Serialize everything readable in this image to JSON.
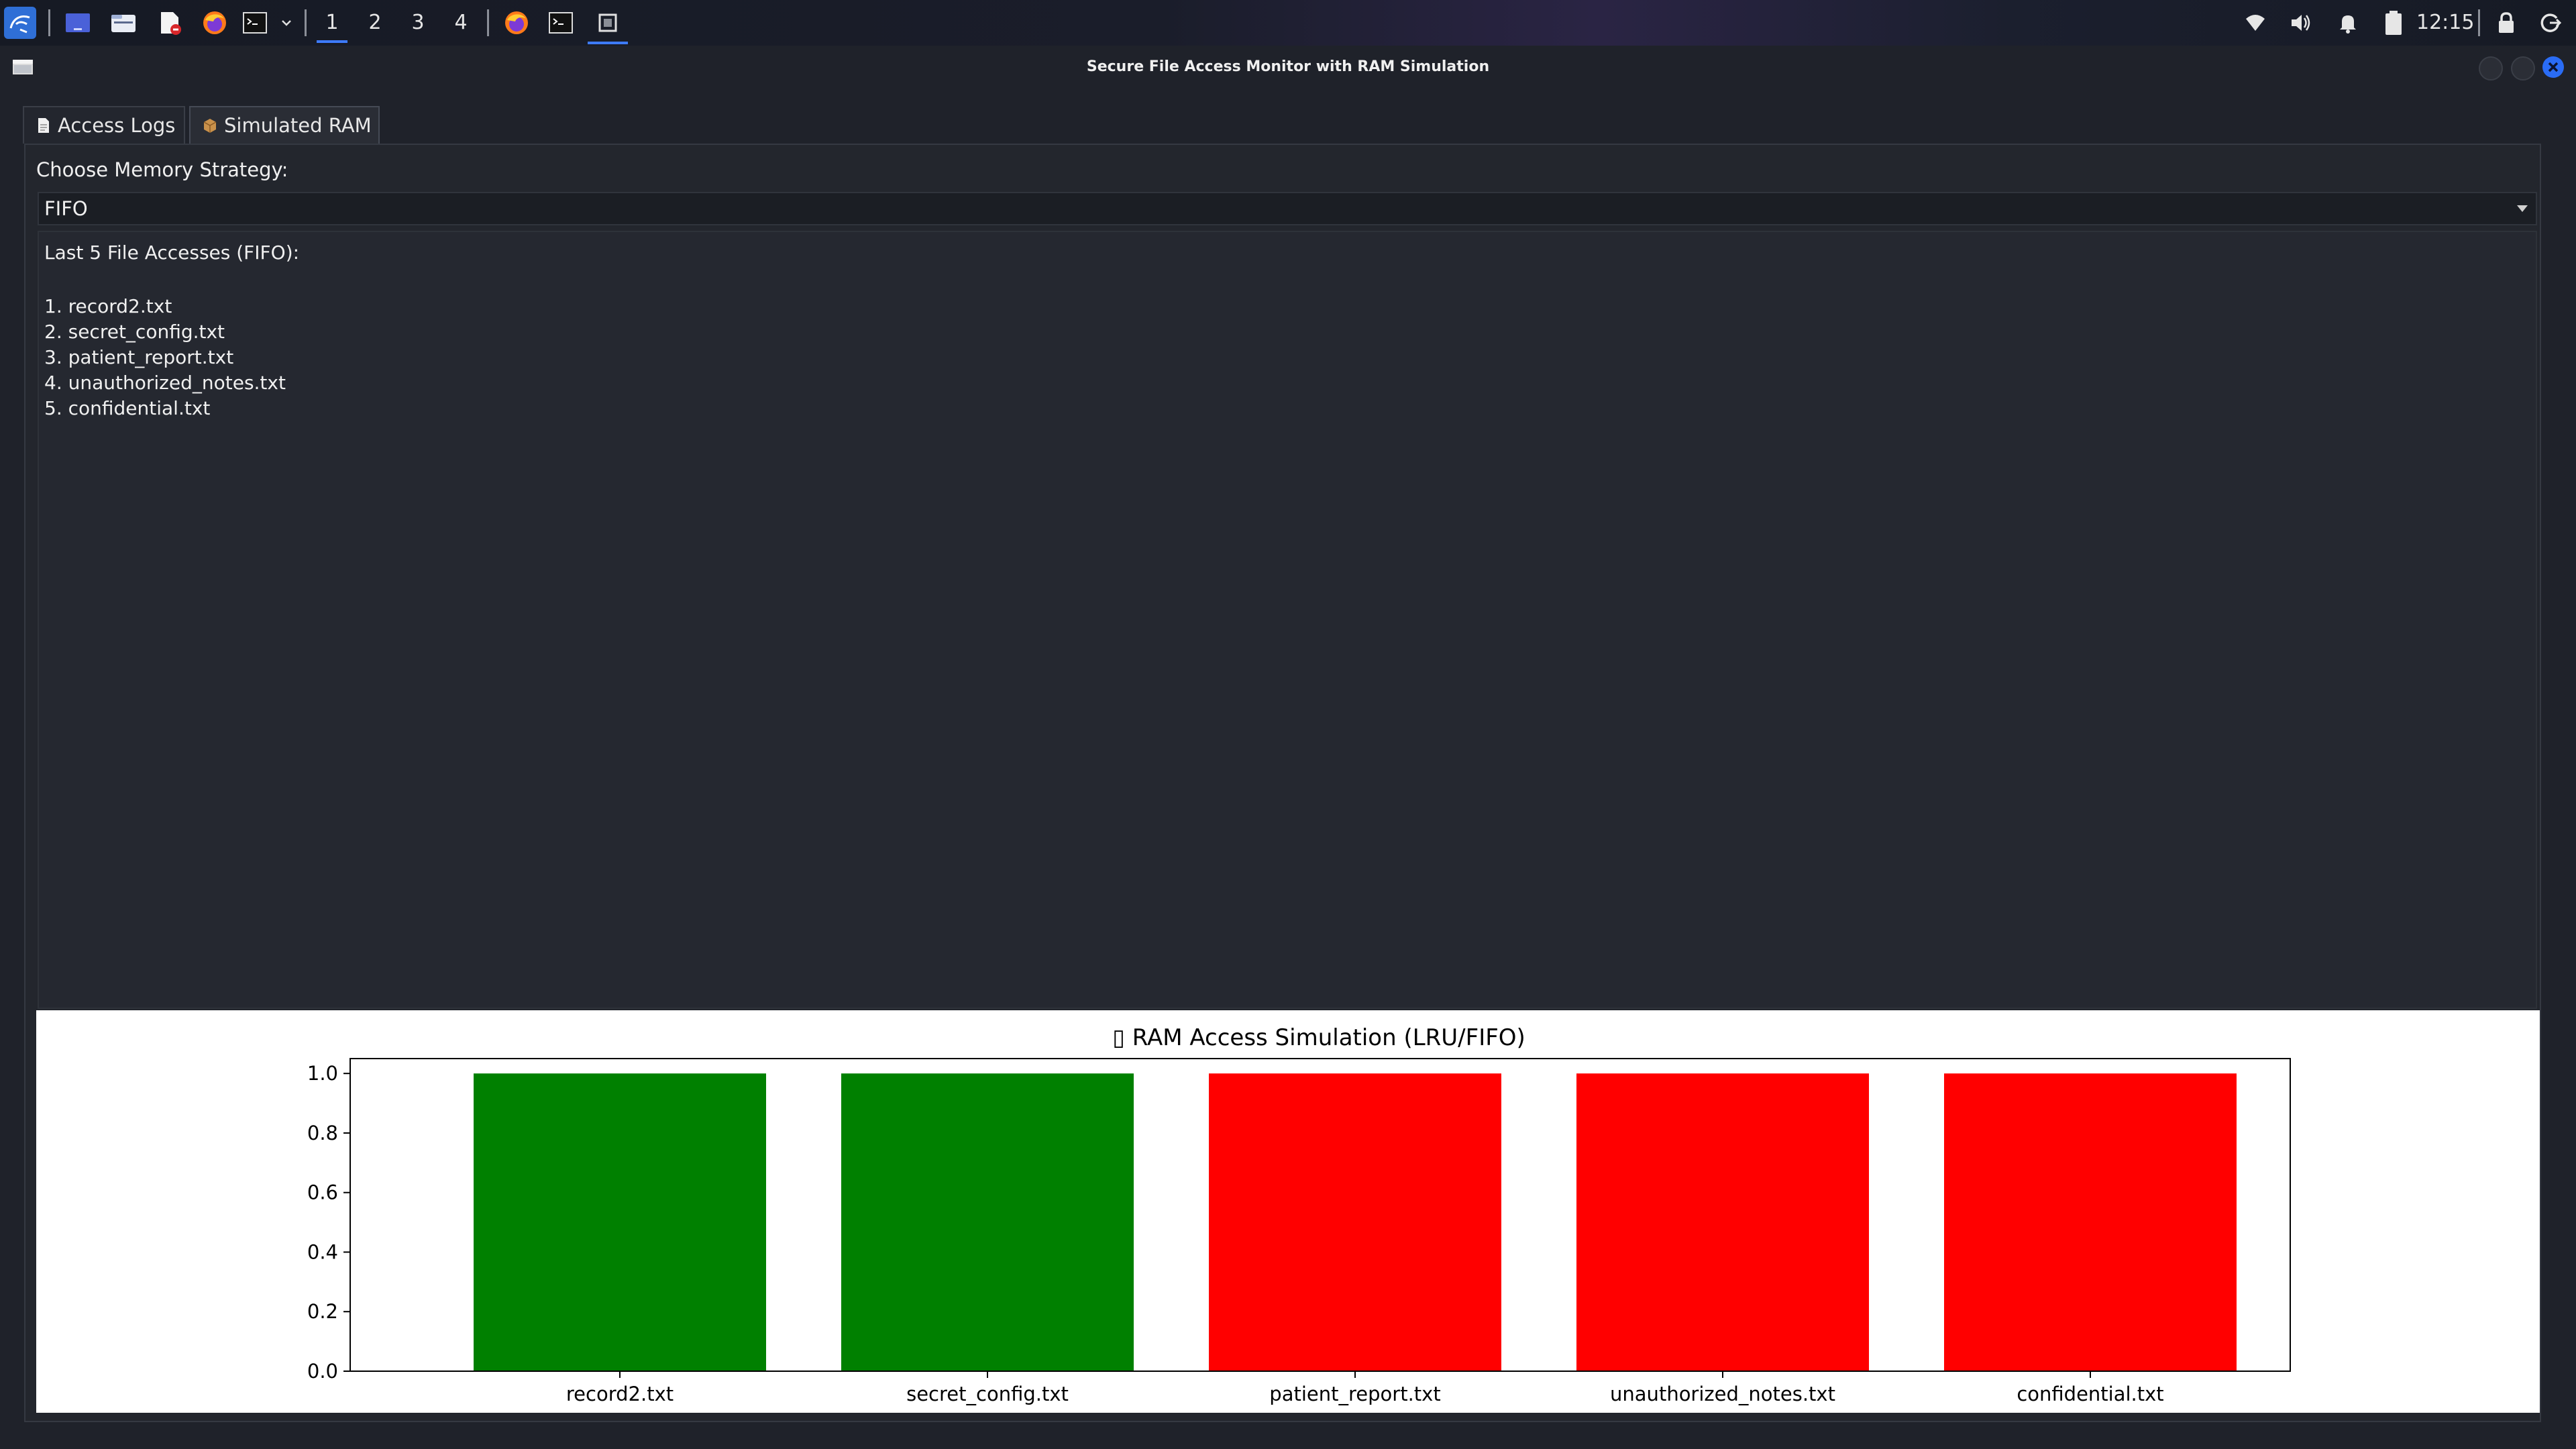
{
  "taskbar": {
    "workspaces": [
      "1",
      "2",
      "3",
      "4"
    ],
    "active_workspace": "1",
    "clock": "12:15"
  },
  "window": {
    "title": "Secure File Access Monitor with RAM Simulation"
  },
  "tabs": [
    {
      "label": "Access Logs",
      "icon": "document-icon",
      "active": false
    },
    {
      "label": "Simulated RAM",
      "icon": "package-icon",
      "active": true
    }
  ],
  "strategy": {
    "label": "Choose Memory Strategy:",
    "selected": "FIFO"
  },
  "output": {
    "heading": "Last 5 File Accesses (FIFO):",
    "items": [
      "1. record2.txt",
      "2. secret_config.txt",
      "3. patient_report.txt",
      "4. unauthorized_notes.txt",
      "5. confidential.txt"
    ]
  },
  "chart_data": {
    "type": "bar",
    "title": "▯ RAM Access Simulation (LRU/FIFO)",
    "categories": [
      "record2.txt",
      "secret_config.txt",
      "patient_report.txt",
      "unauthorized_notes.txt",
      "confidential.txt"
    ],
    "values": [
      1.0,
      1.0,
      1.0,
      1.0,
      1.0
    ],
    "colors": [
      "#008000",
      "#008000",
      "#ff0000",
      "#ff0000",
      "#ff0000"
    ],
    "yticks": [
      "0.0",
      "0.2",
      "0.4",
      "0.6",
      "0.8",
      "1.0"
    ],
    "ylim": [
      0,
      1.05
    ],
    "xlabel": "",
    "ylabel": "",
    "grid": false
  }
}
